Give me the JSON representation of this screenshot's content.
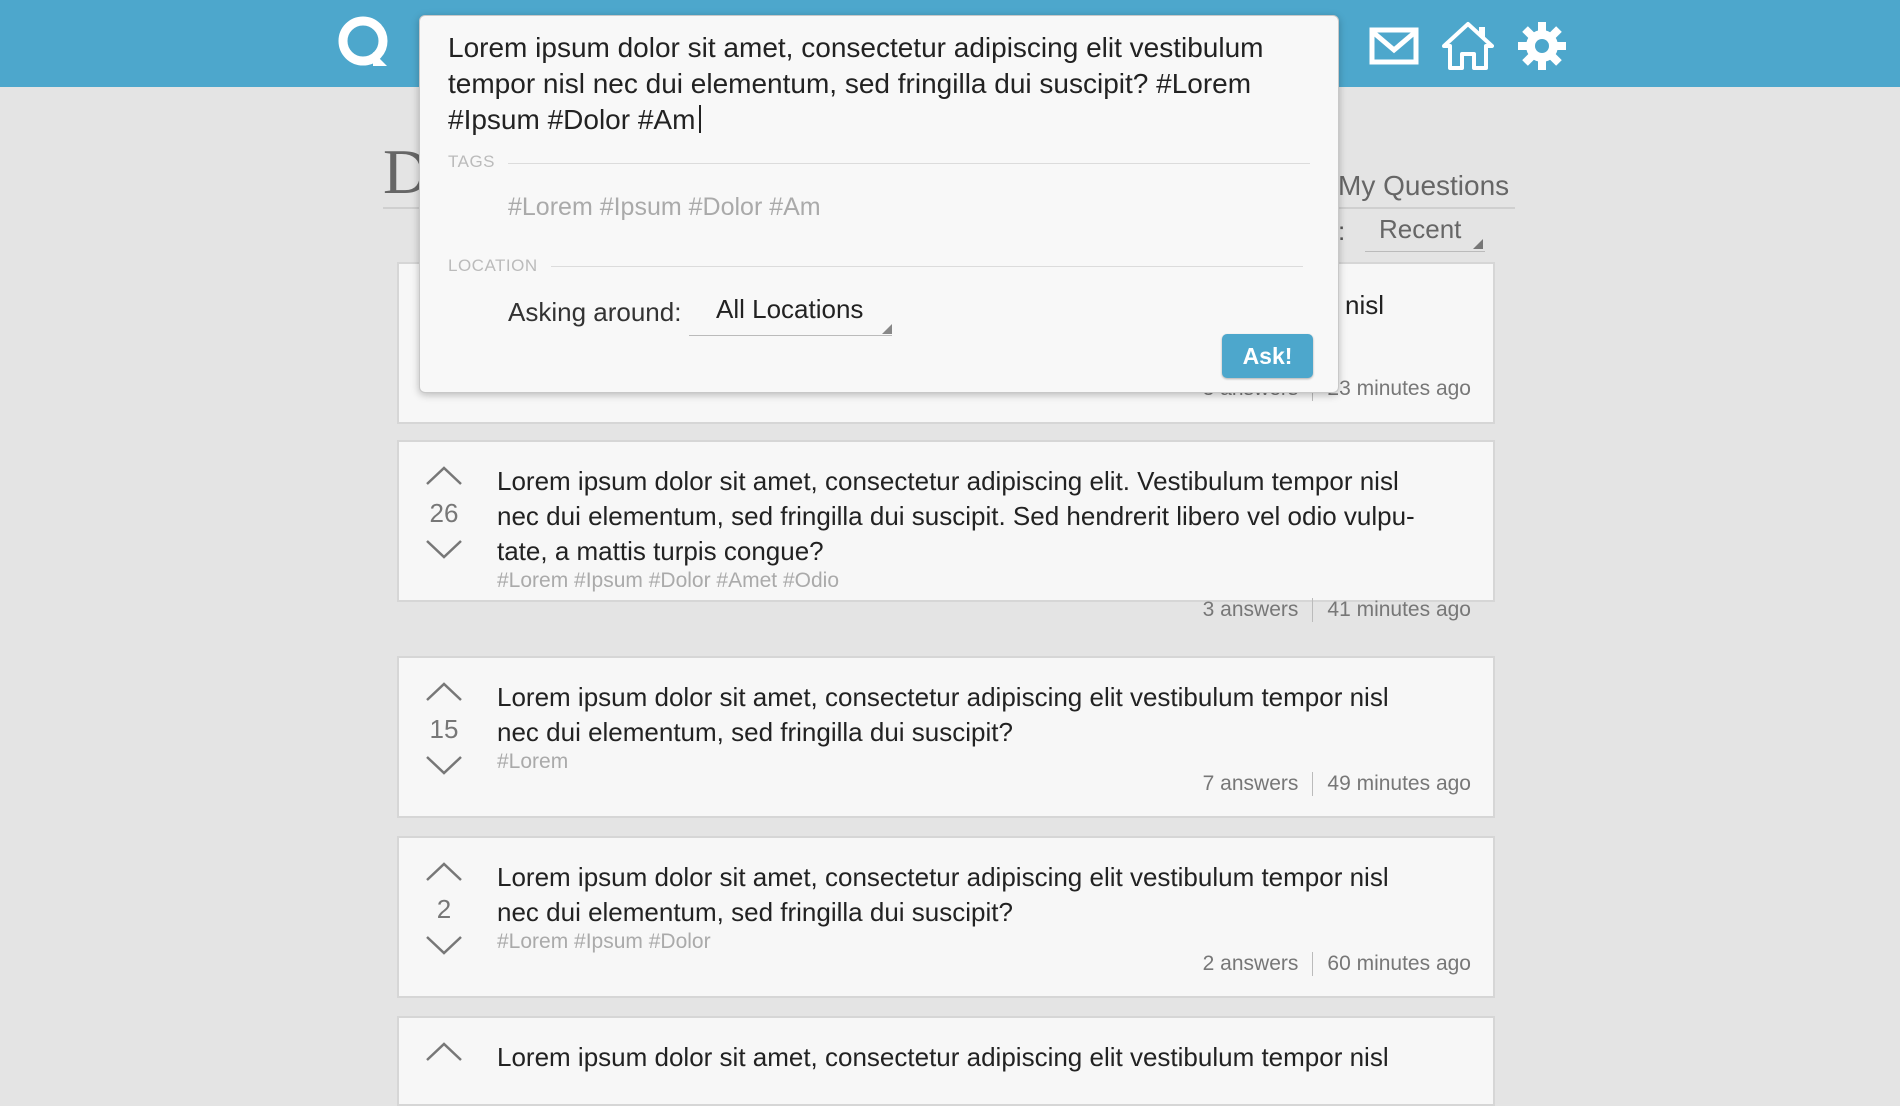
{
  "header": {
    "icons": [
      "search-logo-icon",
      "mail-icon",
      "home-icon",
      "gear-icon"
    ],
    "accent_color": "#4da7cc"
  },
  "page": {
    "title_partial": "D",
    "tab_my_questions": "My Questions",
    "sort_colon": ":",
    "sort_value": "Recent"
  },
  "modal": {
    "question_text": "Lorem ipsum dolor sit amet, consectetur adipiscing elit vestibulum tempor nisl nec dui elementum, sed fringilla dui suscipit? #Lorem #Ipsum #Dolor #Am",
    "tags_label": "TAGS",
    "tags_value": "#Lorem #Ipsum #Dolor #Am",
    "location_label": "LOCATION",
    "asking_around_label": "Asking around:",
    "location_value": "All Locations",
    "ask_button": "Ask!"
  },
  "questions": [
    {
      "text_fragment": "nisl",
      "answers": "3 answers",
      "time": "23 minutes ago"
    },
    {
      "votes": "26",
      "text": "Lorem ipsum dolor sit amet, consectetur adipiscing elit. Vestibulum tempor nisl nec dui elementum, sed fringilla dui suscipit. Sed hendrerit libero vel odio vulpu-tate, a mattis turpis congue?",
      "tags": "#Lorem #Ipsum #Dolor #Amet #Odio",
      "answers": "3 answers",
      "time": "41 minutes ago"
    },
    {
      "votes": "15",
      "text": "Lorem ipsum dolor sit amet, consectetur adipiscing elit vestibulum tempor nisl nec dui elementum, sed fringilla dui suscipit?",
      "tags": "#Lorem",
      "answers": "7 answers",
      "time": "49 minutes ago"
    },
    {
      "votes": "2",
      "text": "Lorem ipsum dolor sit amet, consectetur adipiscing elit vestibulum tempor nisl nec dui elementum, sed fringilla dui suscipit?",
      "tags": "#Lorem #Ipsum #Dolor",
      "answers": "2 answers",
      "time": "60 minutes ago"
    },
    {
      "text": "Lorem ipsum dolor sit amet, consectetur adipiscing elit vestibulum tempor nisl"
    }
  ]
}
